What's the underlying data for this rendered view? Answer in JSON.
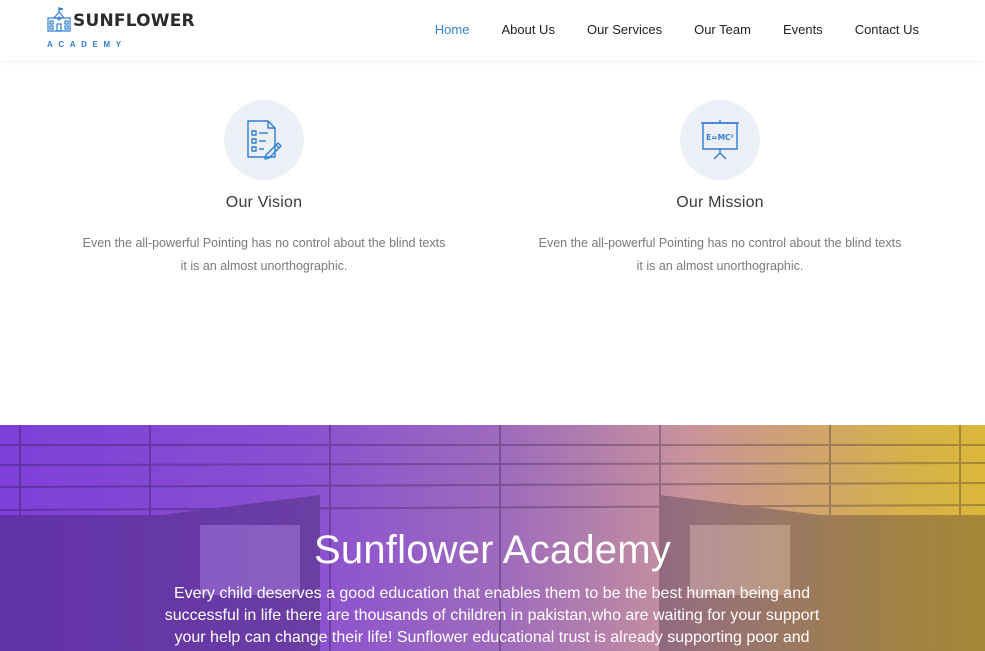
{
  "logo": {
    "title": "SUNFLOWER",
    "subtitle": "ACADEMY",
    "icon": "school-building-icon"
  },
  "nav": {
    "items": [
      {
        "label": "Home",
        "active": true
      },
      {
        "label": "About Us",
        "active": false
      },
      {
        "label": "Our Services",
        "active": false
      },
      {
        "label": "Our Team",
        "active": false
      },
      {
        "label": "Events",
        "active": false
      },
      {
        "label": "Contact Us",
        "active": false
      }
    ]
  },
  "features": [
    {
      "icon": "checklist-document-icon",
      "title": "Our Vision",
      "text_line1": "Even the all-powerful Pointing has no control about the blind texts",
      "text_line2": "it is an almost unorthographic."
    },
    {
      "icon": "whiteboard-formula-icon",
      "icon_text": "E=MC²",
      "title": "Our Mission",
      "text_line1": "Even the all-powerful Pointing has no control about the blind texts",
      "text_line2": "it is an almost unorthographic."
    }
  ],
  "hero": {
    "title": "Sunflower Academy",
    "text": "Every child deserves a good education that enables them to be the best human being and successful in life there are thousands of children in pakistan,who are waiting for your support your help can change their life! Sunflower educational trust is already supporting poor and"
  },
  "colors": {
    "accent": "#2f84d8",
    "hero_gradient_start": "#7e3fd8",
    "hero_gradient_end": "#dbb83a",
    "icon_circle": "#eceff5"
  }
}
